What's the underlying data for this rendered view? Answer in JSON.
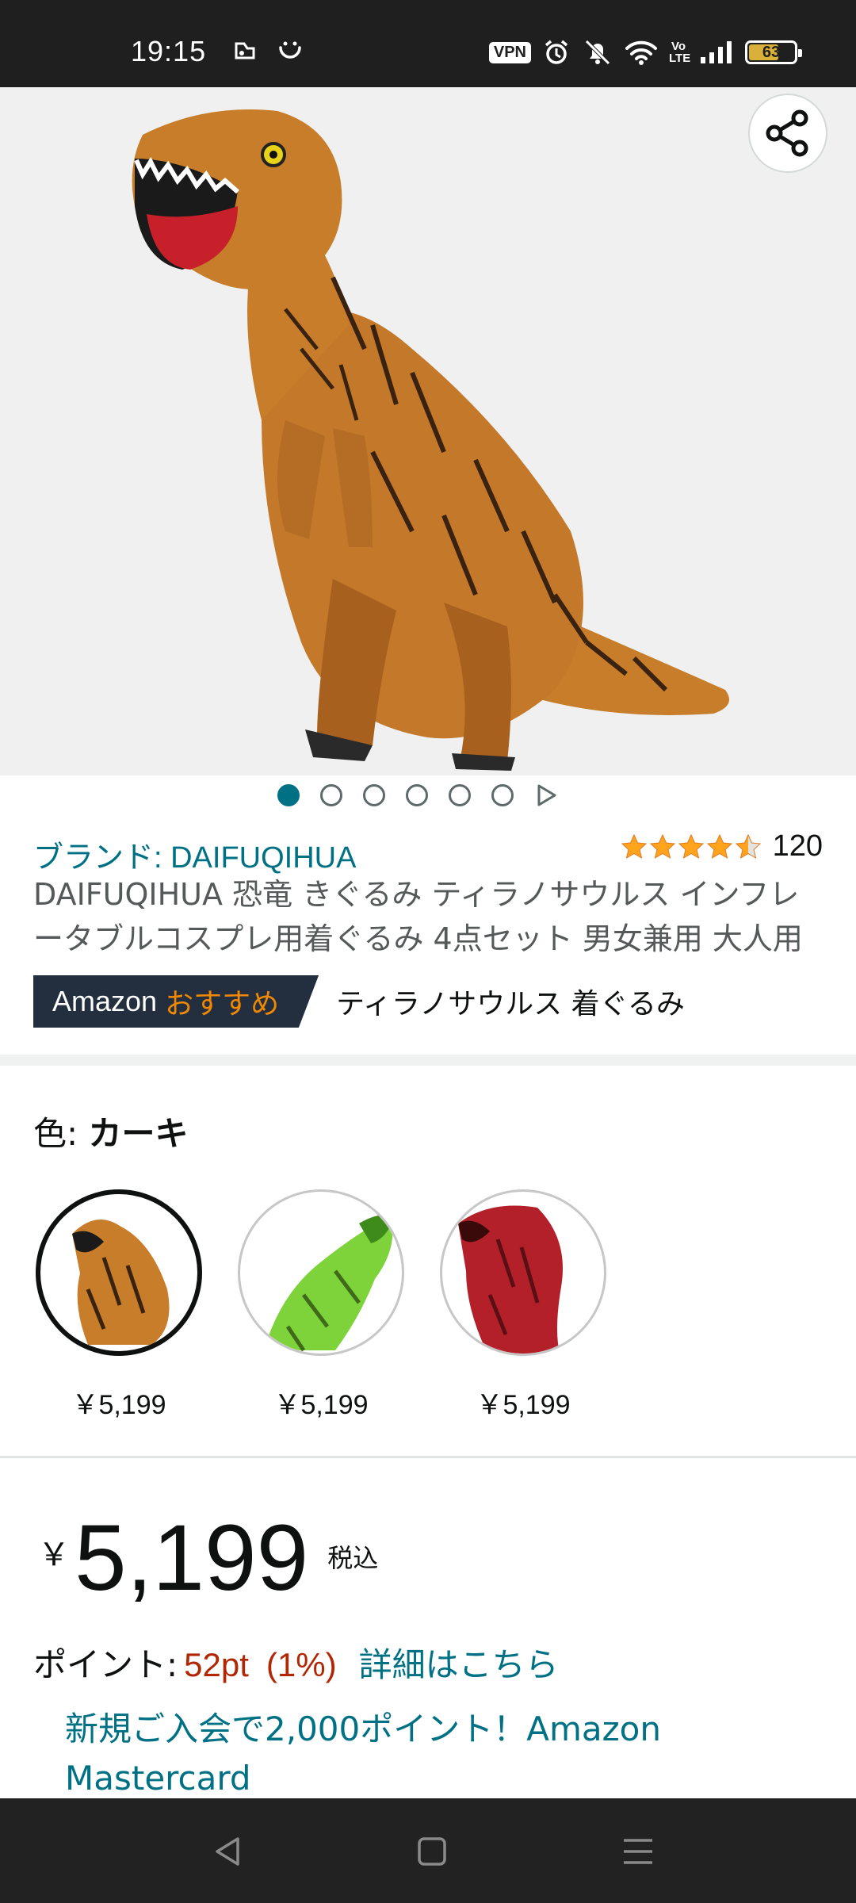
{
  "status_bar": {
    "time": "19:15",
    "vpn": "VPN",
    "volte": "Vo LTE",
    "battery": "63",
    "battery_level": 0.63
  },
  "product": {
    "brand_link": "ブランド: DAIFUQIHUA",
    "rating": 4.5,
    "rating_count": "120",
    "title": "DAIFUQIHUA 恐竜 きぐるみ ティラノサウルス インフレータブルコスプレ用着ぐるみ 4点セット 男女兼用 大人用",
    "image_count": 6,
    "current_image": 1
  },
  "choice": {
    "amazon": "Amazon",
    "recommend": "おすすめ",
    "keyword": "ティラノサウルス 着ぐるみ"
  },
  "color": {
    "label": "色: ",
    "selected": "カーキ",
    "options": [
      {
        "name": "カーキ",
        "price": "￥5,199",
        "color": "#c77d2a"
      },
      {
        "name": "グリーン",
        "price": "￥5,199",
        "color": "#7ed23a"
      },
      {
        "name": "レッド",
        "price": "￥5,199",
        "color": "#b3202a"
      }
    ]
  },
  "price": {
    "currency": "￥",
    "value": "5,199",
    "tax": "税込"
  },
  "points": {
    "label": "ポイント:",
    "value": "52pt",
    "percent": "(1%)",
    "details_link": "詳細はこちら"
  },
  "promo": {
    "text": "新規ご入会で2,000ポイント！Amazon Mastercard"
  },
  "colors": {
    "link": "#007185",
    "price_red": "#b12704",
    "choice_bg": "#232f3e",
    "choice_orange": "#f08804",
    "star": "#ffa41c"
  }
}
